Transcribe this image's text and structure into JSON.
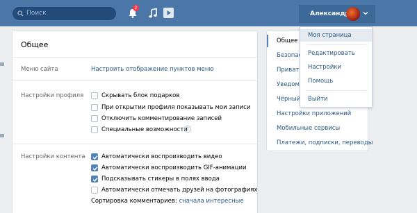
{
  "colors": {
    "topbar": "#4a76a8",
    "link": "#2a5885",
    "checkbox_on": "#5181b8",
    "badge": "#ff3347"
  },
  "header": {
    "search_placeholder": "Поиск",
    "notifications_count": "2",
    "user_name": "Александра"
  },
  "user_menu": {
    "items": [
      "Моя страница",
      "Редактировать",
      "Настройки",
      "Помощь",
      "Выйти"
    ]
  },
  "settings": {
    "title": "Общее",
    "site_menu_label": "Меню сайта",
    "site_menu_link": "Настроить отображение пунктов меню",
    "profile_label": "Настройки профиля",
    "profile_options": [
      {
        "label": "Скрывать блок подарков",
        "checked": false
      },
      {
        "label": "При открытии профиля показывать мои записи",
        "checked": false
      },
      {
        "label": "Отключить комментирование записей",
        "checked": false
      },
      {
        "label": "Специальные возможности",
        "checked": false,
        "help": "?"
      }
    ],
    "content_label": "Настройки контента",
    "content_options": [
      {
        "label": "Автоматически воспроизводить видео",
        "checked": true
      },
      {
        "label": "Автоматически воспроизводить GIF-анимации",
        "checked": true
      },
      {
        "label": "Подсказывать стикеры в полях ввода",
        "checked": true
      },
      {
        "label": "Автоматически отмечать друзей на фотографиях",
        "checked": false
      }
    ],
    "sort_label": "Сортировка комментариев:",
    "sort_value": "сначала интересные"
  },
  "right_menu": {
    "items": [
      "Общее",
      "Безопасность",
      "Приватность",
      "Уведомления",
      "Чёрный список",
      "Настройки приложений",
      "Мобильные сервисы",
      "Платежи, подписки, переводы"
    ]
  }
}
